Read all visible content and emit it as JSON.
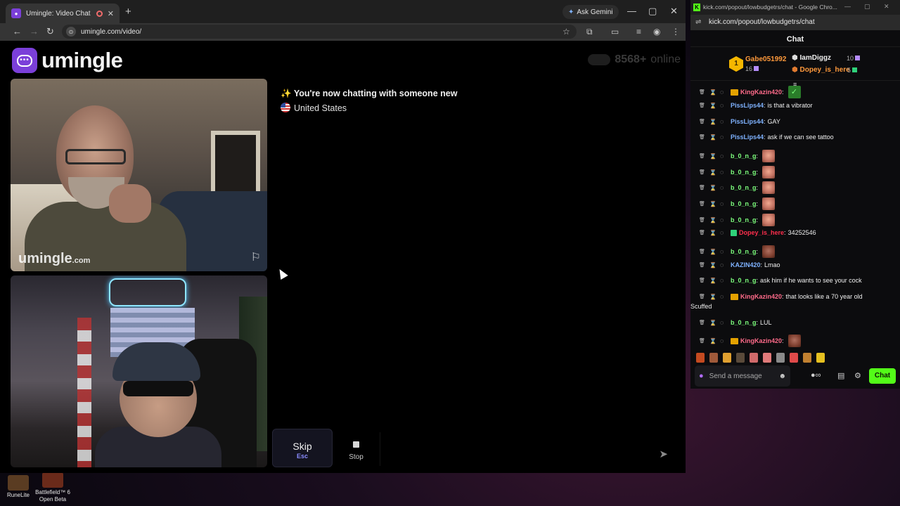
{
  "browser": {
    "tab_title": "Umingle: Video Chat with S",
    "gemini_label": "Ask Gemini",
    "url": "umingle.com/video/"
  },
  "site": {
    "logo_text": "umingle",
    "online_count": "8568+",
    "online_label": "online",
    "watermark": "umingle",
    "watermark_suffix": ".com"
  },
  "chat": {
    "status_line": "You're now chatting with someone new",
    "country": "United States"
  },
  "controls": {
    "skip_label": "Skip",
    "skip_key": "Esc",
    "stop_label": "Stop"
  },
  "kick": {
    "window_title": "kick.com/popout/lowbudgetrs/chat - Google Chro...",
    "url": "kick.com/popout/lowbudgetrs/chat",
    "header": "Chat",
    "top_gifters": [
      {
        "rank": "1",
        "name": "Gabe051992",
        "count": "16"
      },
      {
        "name": "IamDiggz",
        "count": "10"
      },
      {
        "name": "Dopey_is_here",
        "count": "5"
      }
    ],
    "messages": [
      {
        "user": "KingKazin420",
        "text": "",
        "color": "#ff6b8a",
        "emote": "check",
        "crown": true
      },
      {
        "user": "PissLips44",
        "text": "is that a vibrator",
        "color": "#7fb2ff"
      },
      {
        "user": "PissLips44",
        "text": "GAY",
        "color": "#7fb2ff"
      },
      {
        "user": "PissLips44",
        "text": "ask if we can see tattoo",
        "color": "#7fb2ff"
      },
      {
        "user": "b_0_n_g",
        "text": "",
        "color": "#7dff7d",
        "emote": "face"
      },
      {
        "user": "b_0_n_g",
        "text": "",
        "color": "#7dff7d",
        "emote": "face"
      },
      {
        "user": "b_0_n_g",
        "text": "",
        "color": "#7dff7d",
        "emote": "face"
      },
      {
        "user": "b_0_n_g",
        "text": "",
        "color": "#7dff7d",
        "emote": "face"
      },
      {
        "user": "b_0_n_g",
        "text": "",
        "color": "#7dff7d",
        "emote": "face"
      },
      {
        "user": "Dopey_is_here",
        "text": "34252546",
        "color": "#ff2e4d",
        "gem": true
      },
      {
        "user": "b_0_n_g",
        "text": "",
        "color": "#7dff7d",
        "emote": "dark"
      },
      {
        "user": "KAZIN420",
        "text": "Lmao",
        "color": "#7fb2ff"
      },
      {
        "user": "b_0_n_g",
        "text": "ask him if he wants to see your cock",
        "color": "#7dff7d"
      },
      {
        "user": "KingKazin420",
        "text": "that looks like a 70 year old",
        "continuation": "Scuffed",
        "color": "#ff6b8a",
        "crown": true
      },
      {
        "user": "b_0_n_g",
        "text": "LUL",
        "color": "#7dff7d"
      },
      {
        "user": "KingKazin420",
        "text": "",
        "color": "#ff6b8a",
        "emote": "dark",
        "crown": true
      }
    ],
    "input_placeholder": "Send a message",
    "chat_button": "Chat"
  },
  "desktop": {
    "icons": [
      {
        "label": "RuneLite"
      },
      {
        "label": "Battlefield™ 6 Open Beta"
      }
    ]
  },
  "colors": {
    "brand": "#7b3fd9",
    "kick_green": "#53fc18"
  }
}
